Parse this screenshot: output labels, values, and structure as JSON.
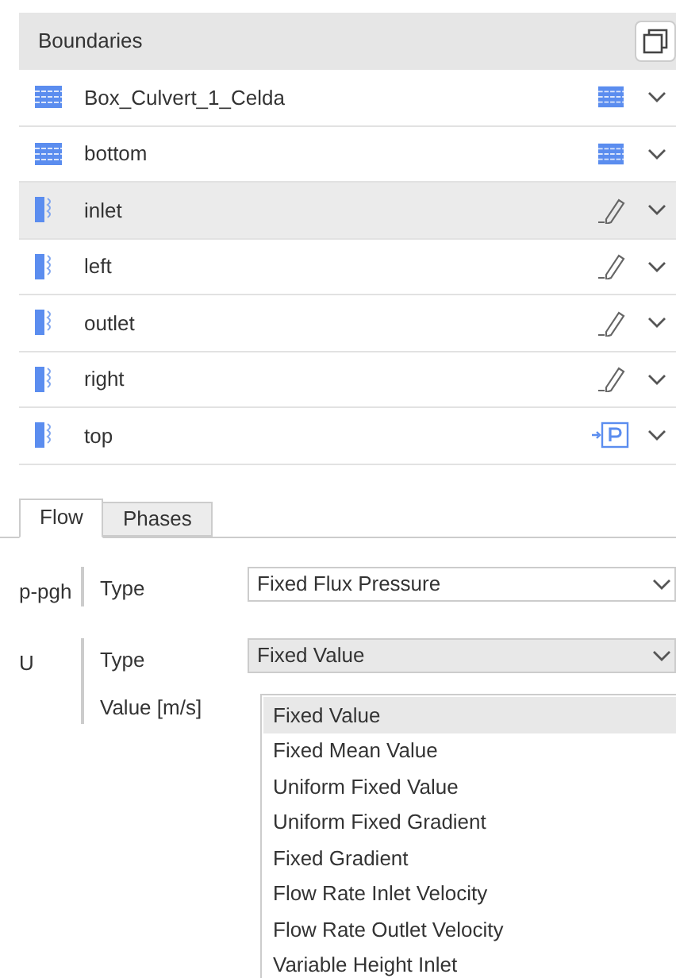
{
  "boundaries": {
    "title": "Boundaries",
    "items": [
      {
        "name": "Box_Culvert_1_Celda",
        "kind": "wall",
        "action": {
          "kind": "wall"
        },
        "selected": false
      },
      {
        "name": "bottom",
        "kind": "wall",
        "action": {
          "kind": "wall"
        },
        "selected": false
      },
      {
        "name": "inlet",
        "kind": "patch",
        "action": {
          "kind": "edit"
        },
        "selected": true
      },
      {
        "name": "left",
        "kind": "patch",
        "action": {
          "kind": "edit"
        },
        "selected": false
      },
      {
        "name": "outlet",
        "kind": "patch",
        "action": {
          "kind": "edit"
        },
        "selected": false
      },
      {
        "name": "right",
        "kind": "patch",
        "action": {
          "kind": "edit"
        },
        "selected": false
      },
      {
        "name": "top",
        "kind": "patch",
        "action": {
          "kind": "pressure"
        },
        "selected": false
      }
    ]
  },
  "tabs": [
    {
      "label": "Flow",
      "selected": true
    },
    {
      "label": "Phases",
      "selected": false
    }
  ],
  "fields": [
    {
      "name": "p-pgh",
      "rows": [
        {
          "label": "Type",
          "value": "Fixed Flux Pressure",
          "open": false
        }
      ]
    },
    {
      "name": "U",
      "rows": [
        {
          "label": "Type",
          "value": "Fixed Value",
          "open": true
        },
        {
          "label": "Value [m/s]"
        }
      ]
    }
  ],
  "dropdown": [
    {
      "label": "Fixed Value",
      "selected": true
    },
    {
      "label": "Fixed Mean Value",
      "selected": false
    },
    {
      "label": "Uniform Fixed Value",
      "selected": false
    },
    {
      "label": "Uniform Fixed Gradient",
      "selected": false
    },
    {
      "label": "Fixed Gradient",
      "selected": false
    },
    {
      "label": "Flow Rate Inlet Velocity",
      "selected": false
    },
    {
      "label": "Flow Rate Outlet Velocity",
      "selected": false
    },
    {
      "label": "Variable Height Inlet",
      "selected": false
    }
  ]
}
